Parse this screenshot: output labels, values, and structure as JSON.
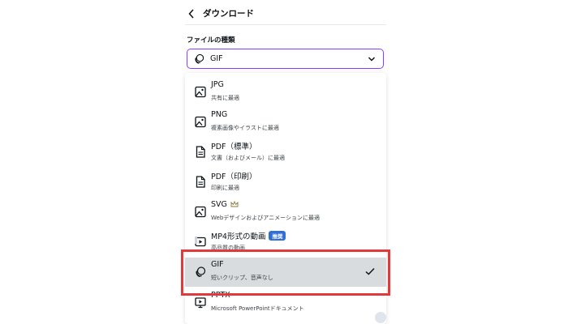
{
  "header": {
    "title": "ダウンロード"
  },
  "section_label": "ファイルの種類",
  "select": {
    "value": "GIF"
  },
  "formats": [
    {
      "name": "JPG",
      "desc": "共有に最適",
      "icon": "image-icon"
    },
    {
      "name": "PNG",
      "desc": "複素画像やイラストに最適",
      "icon": "image-icon"
    },
    {
      "name": "PDF（標準）",
      "desc": "文書（およびメール）に最適",
      "icon": "document-icon"
    },
    {
      "name": "PDF（印刷）",
      "desc": "印刷に最適",
      "icon": "document-icon"
    },
    {
      "name": "SVG",
      "desc": "Webデザインおよびアニメーションに最適",
      "icon": "image-icon",
      "premium": "crown-icon"
    },
    {
      "name": "MP4形式の動画",
      "desc": "高品質の動画",
      "icon": "video-icon",
      "badge": "推奨"
    },
    {
      "name": "GIF",
      "desc": "短いクリップ、音声なし",
      "icon": "gif-icon",
      "selected": true
    },
    {
      "name": "PPTX",
      "desc": "Microsoft PowerPointドキュメント",
      "icon": "presentation-icon"
    }
  ],
  "colors": {
    "accent": "#8b3dff",
    "badge": "#2f6fd6",
    "highlight": "#e23a3a",
    "selected_bg": "#d9dcdf"
  }
}
